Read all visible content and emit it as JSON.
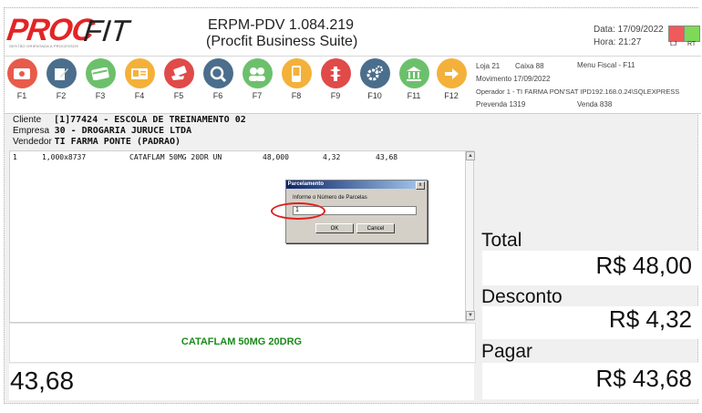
{
  "header": {
    "logo_proc": "PROC",
    "logo_fit": "FIT",
    "logo_tagline": "GESTÃO ORIENTADA A PROCESSOS",
    "title": "ERPM-PDV 1.084.219",
    "subtitle": "(Procfit Business Suite)",
    "date_label": "Data: 17/09/2022",
    "time_label": "Hora: 21:27",
    "lj_label": "LJ",
    "rt_label": "RT",
    "lj_color": "#f05a5a",
    "rt_color": "#7ed957"
  },
  "function_keys": [
    {
      "label": "F1",
      "icon": "money-icon",
      "color": "#e85a4a"
    },
    {
      "label": "F2",
      "icon": "edit-icon",
      "color": "#4a6e8c"
    },
    {
      "label": "F3",
      "icon": "card-icon",
      "color": "#6cc06c"
    },
    {
      "label": "F4",
      "icon": "id-card-icon",
      "color": "#f4b13a"
    },
    {
      "label": "F5",
      "icon": "hand-card-icon",
      "color": "#e04a48"
    },
    {
      "label": "F6",
      "icon": "search-icon",
      "color": "#4a6e8c"
    },
    {
      "label": "F7",
      "icon": "users-icon",
      "color": "#6cc06c"
    },
    {
      "label": "F8",
      "icon": "mobile-icon",
      "color": "#f4b13a"
    },
    {
      "label": "F9",
      "icon": "medical-icon",
      "color": "#e04a48"
    },
    {
      "label": "F10",
      "icon": "gear-icon",
      "color": "#4a6e8c"
    },
    {
      "label": "F11",
      "icon": "bank-icon",
      "color": "#6cc06c"
    },
    {
      "label": "F12",
      "icon": "arrow-right-icon",
      "color": "#f4b13a"
    }
  ],
  "session": {
    "loja": "Loja  21",
    "caixa": "Caixa  88",
    "menu_fiscal": "Menu Fiscal - F11",
    "movimento": "Movimento  17/09/2022",
    "operador": "Operador   1 - TI FARMA PON'SAT IPD192.168.0.24\\SQLEXPRESS",
    "prevenda": "Prevenda   1319",
    "venda": "Venda   838"
  },
  "customer": {
    "cliente_label": "Cliente",
    "cliente_value": "[1]77424 - ESCOLA DE TREINAMENTO 02",
    "empresa_label": "Empresa",
    "empresa_value": "30 - DROGARIA JURUCE LTDA",
    "vendedor_label": "Vendedor",
    "vendedor_value": "TI FARMA PONTE (PADRAO)"
  },
  "items": [
    {
      "seq": "1",
      "qty": "1,000x8737",
      "desc": "CATAFLAM 50MG 20DR UN",
      "price": "48,000",
      "discount": "4,32",
      "total": "43,68"
    }
  ],
  "current_product": "CATAFLAM 50MG 20DRG",
  "current_value": "43,68",
  "totals": {
    "total_label": "Total",
    "total_value": "R$ 48,00",
    "desconto_label": "Desconto",
    "desconto_value": "R$ 4,32",
    "pagar_label": "Pagar",
    "pagar_value": "R$ 43,68"
  },
  "dialog": {
    "title": "Parcelamento",
    "close": "x",
    "prompt": "Informe o Número de Parcelas",
    "input_value": "1",
    "ok_label": "OK",
    "cancel_label": "Cancel"
  }
}
